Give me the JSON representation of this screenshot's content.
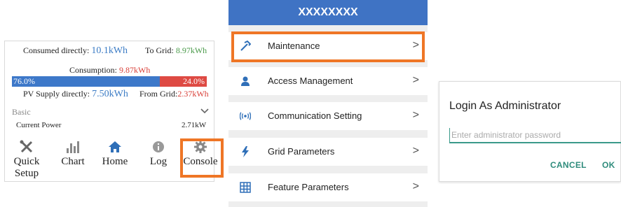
{
  "panel1": {
    "consumed_directly_label": "Consumed directly:",
    "consumed_directly_value": "10.1kWh",
    "to_grid_label": "To Grid:",
    "to_grid_value": "8.97kWh",
    "consumption_label": "Consumption:",
    "consumption_value": "9.87kWh",
    "bar_left_label": "76.0%",
    "bar_right_label": "24.0%",
    "bar_left_fraction": 0.76,
    "pv_supply_label": "PV Supply directly:",
    "pv_supply_value": "7.50kWh",
    "from_grid_label": "From Grid:",
    "from_grid_value": "2.37kWh",
    "section_label": "Basic",
    "current_power_label": "Current Power",
    "current_power_value": "2.71kW",
    "nav": [
      {
        "label": "Quick Setup",
        "icon": "tools-icon"
      },
      {
        "label": "Chart",
        "icon": "bar-chart-icon"
      },
      {
        "label": "Home",
        "icon": "home-icon"
      },
      {
        "label": "Log",
        "icon": "info-icon"
      },
      {
        "label": "Console",
        "icon": "gear-icon"
      }
    ]
  },
  "panel2": {
    "title": "XXXXXXXX",
    "items": [
      {
        "label": "Maintenance",
        "icon": "hammer-icon",
        "chevron": ">"
      },
      {
        "label": "Access Management",
        "icon": "person-icon",
        "chevron": ">"
      },
      {
        "label": "Communication Setting",
        "icon": "signal-icon",
        "chevron": ">"
      },
      {
        "label": "Grid Parameters",
        "icon": "lightning-icon",
        "chevron": ">"
      },
      {
        "label": "Feature Parameters",
        "icon": "grid-icon",
        "chevron": ">"
      }
    ]
  },
  "panel3": {
    "title": "Login As Administrator",
    "placeholder": "Enter administrator password",
    "cancel_label": "CANCEL",
    "ok_label": "OK"
  },
  "colors": {
    "highlight": "#ef7626",
    "header_blue": "#3f73c4",
    "bar_blue": "#3d78c9",
    "bar_red": "#de4a43",
    "value_blue": "#3c7cc5",
    "value_green": "#4a9a4a",
    "value_red": "#d9413a",
    "dialog_accent": "#2f8c7c"
  }
}
